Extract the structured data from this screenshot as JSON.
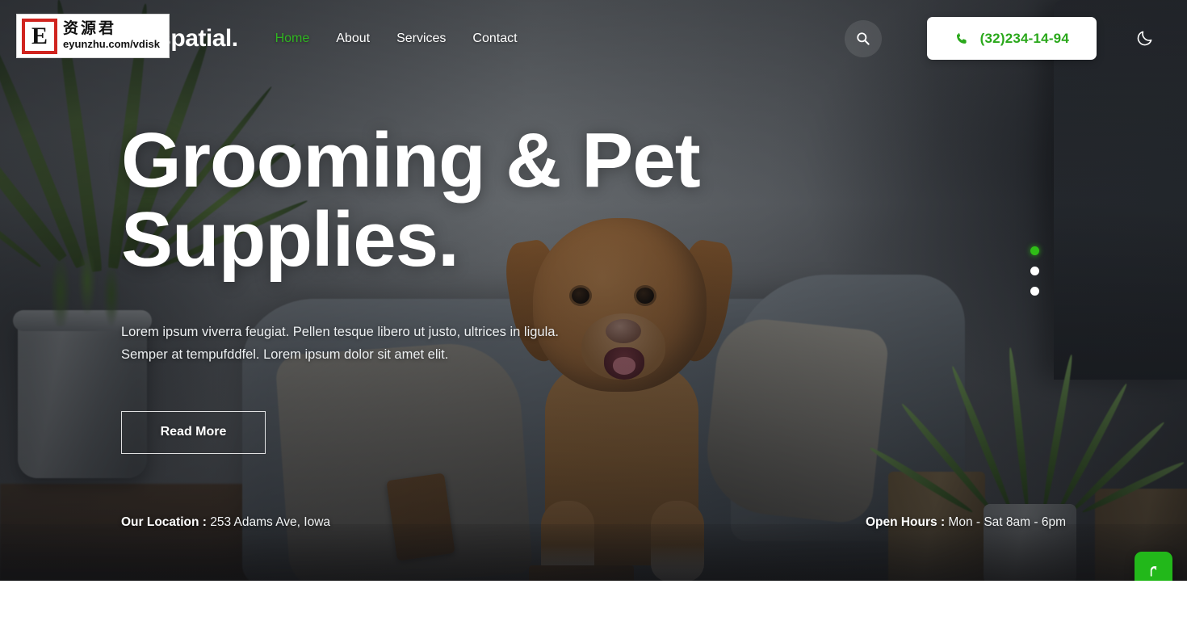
{
  "header": {
    "brand": "Petspatial.",
    "nav": [
      {
        "label": "Home",
        "active": true
      },
      {
        "label": "About",
        "active": false
      },
      {
        "label": "Services",
        "active": false
      },
      {
        "label": "Contact",
        "active": false
      }
    ],
    "search_icon": "search-icon",
    "phone_icon": "phone-icon",
    "phone_number": "(32)234-14-94",
    "dark_mode_icon": "moon-icon"
  },
  "hero": {
    "title_line1": "Grooming & Pet",
    "title_line2": "Supplies.",
    "description": "Lorem ipsum viverra feugiat. Pellen tesque libero ut justo, ultrices in ligula. Semper at tempufddfel. Lorem ipsum dolor sit amet elit.",
    "cta_label": "Read More",
    "location_label": "Our Location :",
    "location_value": "253 Adams Ave, Iowa",
    "hours_label": "Open Hours :",
    "hours_value": "Mon - Sat 8am - 6pm",
    "slides": [
      {
        "index": "1",
        "active": true
      },
      {
        "index": "2",
        "active": false
      },
      {
        "index": "3",
        "active": false
      }
    ]
  },
  "scroll_top": {
    "icon": "arrow-up-icon"
  },
  "watermark": {
    "letter": "E",
    "chinese": "资源君",
    "url": "eyunzhu.com/vdisk"
  },
  "colors": {
    "accent_green": "#2fb520",
    "phone_green": "#2aa81b",
    "button_green": "#22b81a",
    "white": "#ffffff"
  }
}
